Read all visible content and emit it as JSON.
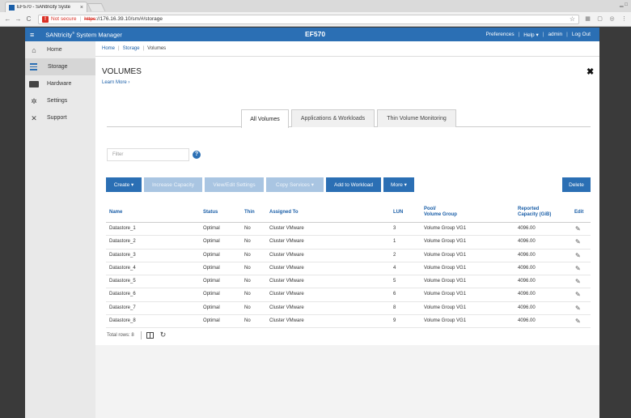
{
  "browser": {
    "tab_title": "EF570 - SANtricity Syste",
    "tab_close": "×",
    "not_secure": "Not secure",
    "url_scheme": "https",
    "url_rest": "://176.16.39.10/sm/#/storage"
  },
  "header": {
    "brand_name": "SANtricity",
    "brand_mark": "®",
    "brand_suffix": " System Manager",
    "system_name": "EF570",
    "links": {
      "preferences": "Preferences",
      "help": "Help ▾",
      "user": "admin",
      "logout": "Log Out"
    }
  },
  "sidebar": {
    "items": [
      {
        "label": "Home",
        "icon": "home-icon"
      },
      {
        "label": "Storage",
        "icon": "storage-icon"
      },
      {
        "label": "Hardware",
        "icon": "hardware-icon"
      },
      {
        "label": "Settings",
        "icon": "gear-icon"
      },
      {
        "label": "Support",
        "icon": "tools-icon"
      }
    ],
    "active": "Storage"
  },
  "breadcrumb": [
    "Home",
    "Storage",
    "Volumes"
  ],
  "page": {
    "title": "VOLUMES",
    "learn_more": "Learn More ›",
    "tabs": [
      "All Volumes",
      "Applications & Workloads",
      "Thin Volume Monitoring"
    ],
    "active_tab": "All Volumes",
    "filter_placeholder": "Filter"
  },
  "toolbar": {
    "create": "Create ▾",
    "increase_capacity": "Increase Capacity",
    "view_edit_settings": "View/Edit Settings",
    "copy_services": "Copy Services ▾",
    "add_to_workload": "Add to Workload",
    "more": "More ▾",
    "delete": "Delete"
  },
  "table": {
    "headers": {
      "name": "Name",
      "status": "Status",
      "thin": "Thin",
      "assigned_to": "Assigned To",
      "lun": "LUN",
      "pool_1": "Pool/",
      "pool_2": "Volume Group",
      "capacity_1": "Reported",
      "capacity_2": "Capacity (GiB)",
      "edit": "Edit"
    },
    "rows": [
      {
        "name": "Datastore_1",
        "status": "Optimal",
        "thin": "No",
        "assigned": "Cluster VMware",
        "lun": "3",
        "pool": "Volume Group VG1",
        "capacity": "4096.00"
      },
      {
        "name": "Datastore_2",
        "status": "Optimal",
        "thin": "No",
        "assigned": "Cluster VMware",
        "lun": "1",
        "pool": "Volume Group VG1",
        "capacity": "4096.00"
      },
      {
        "name": "Datastore_3",
        "status": "Optimal",
        "thin": "No",
        "assigned": "Cluster VMware",
        "lun": "2",
        "pool": "Volume Group VG1",
        "capacity": "4096.00"
      },
      {
        "name": "Datastore_4",
        "status": "Optimal",
        "thin": "No",
        "assigned": "Cluster VMware",
        "lun": "4",
        "pool": "Volume Group VG1",
        "capacity": "4096.00"
      },
      {
        "name": "Datastore_5",
        "status": "Optimal",
        "thin": "No",
        "assigned": "Cluster VMware",
        "lun": "5",
        "pool": "Volume Group VG1",
        "capacity": "4096.00"
      },
      {
        "name": "Datastore_6",
        "status": "Optimal",
        "thin": "No",
        "assigned": "Cluster VMware",
        "lun": "6",
        "pool": "Volume Group VG1",
        "capacity": "4096.00"
      },
      {
        "name": "Datastore_7",
        "status": "Optimal",
        "thin": "No",
        "assigned": "Cluster VMware",
        "lun": "8",
        "pool": "Volume Group VG1",
        "capacity": "4096.00"
      },
      {
        "name": "Datastore_8",
        "status": "Optimal",
        "thin": "No",
        "assigned": "Cluster VMware",
        "lun": "9",
        "pool": "Volume Group VG1",
        "capacity": "4096.00"
      }
    ],
    "total_rows": "Total rows: 8"
  },
  "colors": {
    "accent": "#2b6fb4",
    "accent_disabled": "#a9c5e2",
    "warning": "#d93025"
  }
}
